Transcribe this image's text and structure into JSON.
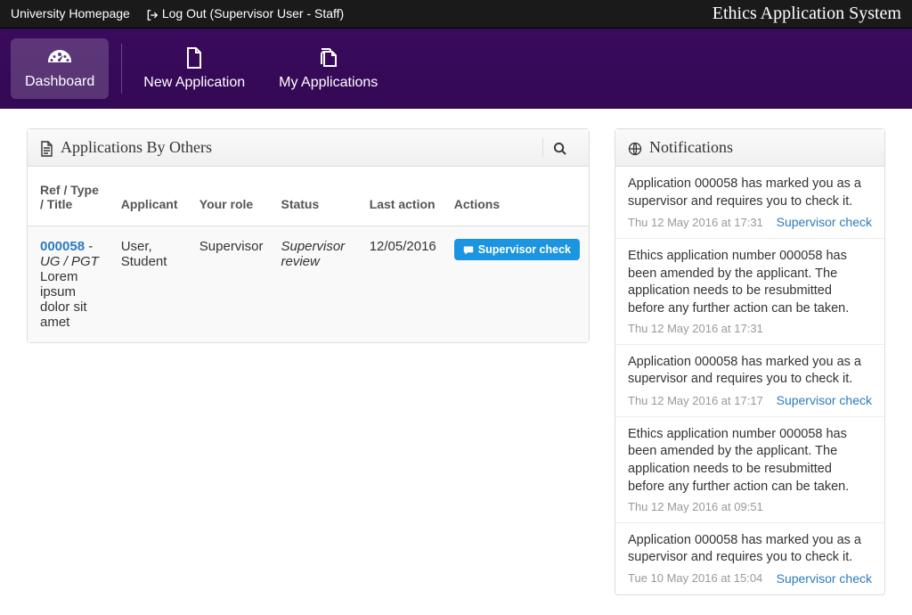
{
  "topbar": {
    "homepage": "University Homepage",
    "logout": "Log Out (Supervisor User - Staff)",
    "brand": "Ethics Application System"
  },
  "nav": {
    "dashboard": "Dashboard",
    "new_app": "New Application",
    "my_apps": "My Applications"
  },
  "applications_panel": {
    "title": "Applications By Others",
    "columns": {
      "ref": "Ref / Type / Title",
      "applicant": "Applicant",
      "role": "Your role",
      "status": "Status",
      "last_action": "Last action",
      "actions": "Actions"
    },
    "rows": [
      {
        "ref": "000058",
        "sep": " - ",
        "type": "UG / PGT",
        "title": "Lorem ipsum dolor sit amet",
        "applicant": "User, Student",
        "role": "Supervisor",
        "status": "Supervisor review",
        "last_action": "12/05/2016",
        "action_label": "Supervisor check"
      }
    ]
  },
  "notifications_panel": {
    "title": "Notifications",
    "items": [
      {
        "text": "Application 000058 has marked you as a supervisor and requires you to check it.",
        "time": "Thu 12 May 2016 at 17:31",
        "action": "Supervisor check"
      },
      {
        "text": "Ethics application number 000058 has been amended by the applicant. The application needs to be resubmitted before any further action can be taken.",
        "time": "Thu 12 May 2016 at 17:31",
        "action": ""
      },
      {
        "text": "Application 000058 has marked you as a supervisor and requires you to check it.",
        "time": "Thu 12 May 2016 at 17:17",
        "action": "Supervisor check"
      },
      {
        "text": "Ethics application number 000058 has been amended by the applicant. The application needs to be resubmitted before any further action can be taken.",
        "time": "Thu 12 May 2016 at 09:51",
        "action": ""
      },
      {
        "text": "Application 000058 has marked you as a supervisor and requires you to check it.",
        "time": "Tue 10 May 2016 at 15:04",
        "action": "Supervisor check"
      }
    ]
  }
}
